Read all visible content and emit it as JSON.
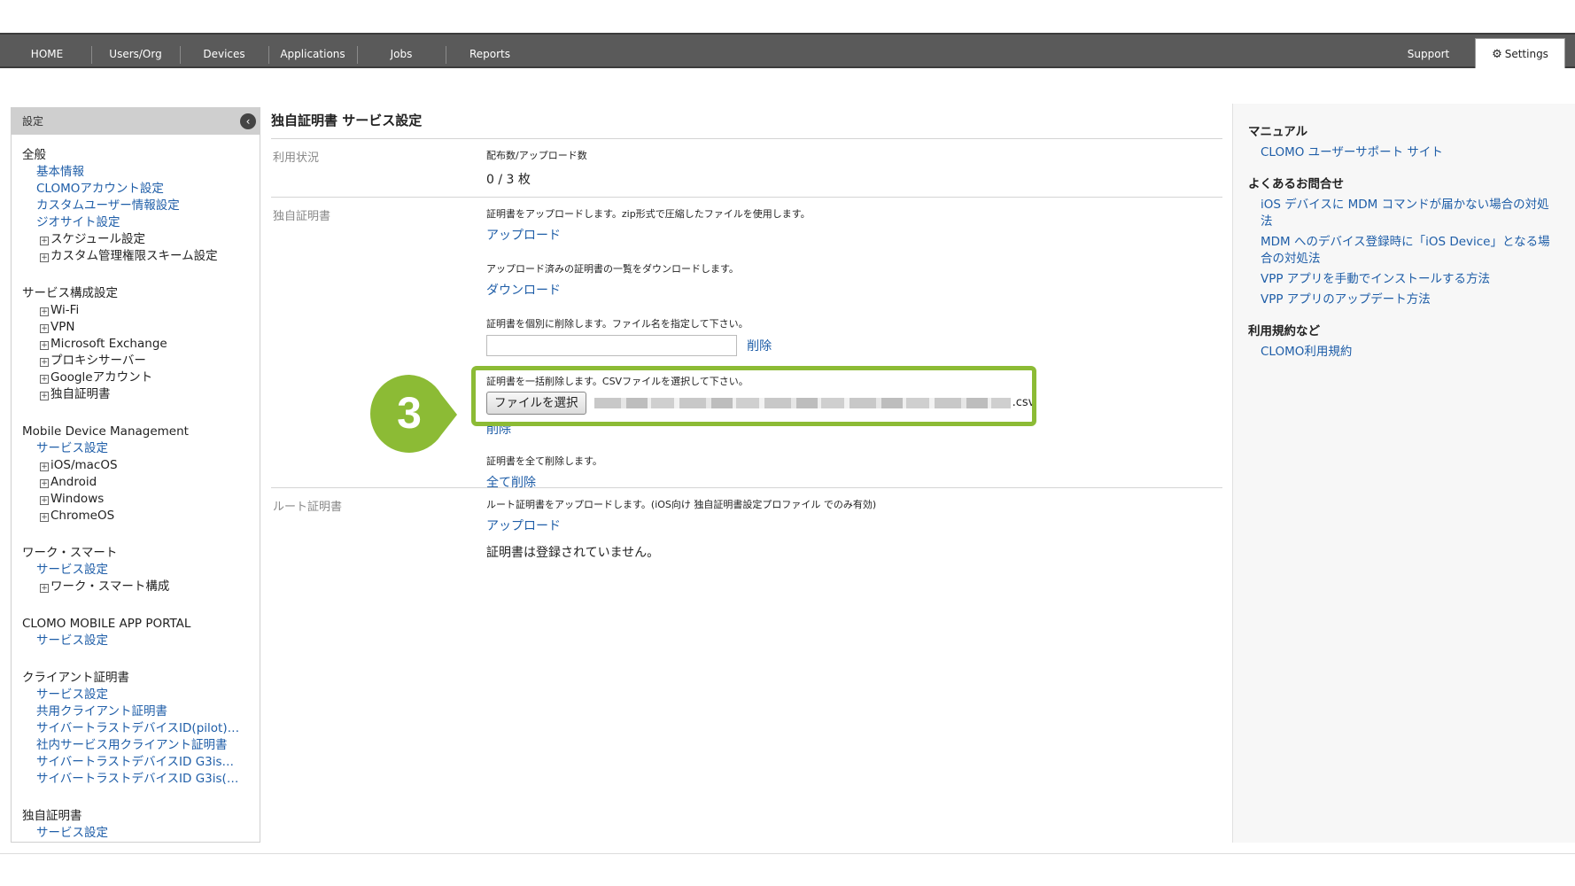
{
  "nav": {
    "items": [
      "HOME",
      "Users/Org",
      "Devices",
      "Applications",
      "Jobs",
      "Reports"
    ],
    "support": "Support",
    "settings": "Settings"
  },
  "sidebar": {
    "header": "設定",
    "groups": [
      {
        "title": "全般",
        "items": [
          {
            "label": "基本情報",
            "type": "link"
          },
          {
            "label": "CLOMOアカウント設定",
            "type": "link"
          },
          {
            "label": "カスタムユーザー情報設定",
            "type": "link"
          },
          {
            "label": "ジオサイト設定",
            "type": "link"
          },
          {
            "label": "スケジュール設定",
            "type": "expand"
          },
          {
            "label": "カスタム管理権限スキーム設定",
            "type": "expand"
          }
        ]
      },
      {
        "title": "サービス構成設定",
        "items": [
          {
            "label": "Wi-Fi",
            "type": "expand"
          },
          {
            "label": "VPN",
            "type": "expand"
          },
          {
            "label": "Microsoft Exchange",
            "type": "expand"
          },
          {
            "label": "プロキシサーバー",
            "type": "expand"
          },
          {
            "label": "Googleアカウント",
            "type": "expand"
          },
          {
            "label": "独自証明書",
            "type": "expand"
          }
        ]
      },
      {
        "title": "Mobile Device Management",
        "items": [
          {
            "label": "サービス設定",
            "type": "link"
          },
          {
            "label": "iOS/macOS",
            "type": "expand"
          },
          {
            "label": "Android",
            "type": "expand"
          },
          {
            "label": "Windows",
            "type": "expand"
          },
          {
            "label": "ChromeOS",
            "type": "expand"
          }
        ]
      },
      {
        "title": "ワーク・スマート",
        "items": [
          {
            "label": "サービス設定",
            "type": "link"
          },
          {
            "label": "ワーク・スマート構成",
            "type": "expand"
          }
        ]
      },
      {
        "title": "CLOMO MOBILE APP PORTAL",
        "items": [
          {
            "label": "サービス設定",
            "type": "link"
          }
        ]
      },
      {
        "title": "クライアント証明書",
        "items": [
          {
            "label": "サービス設定",
            "type": "link"
          },
          {
            "label": "共用クライアント証明書",
            "type": "link"
          },
          {
            "label": "サイバートラストデバイスID(pilot)…",
            "type": "link"
          },
          {
            "label": "社内サービス用クライアント証明書",
            "type": "link"
          },
          {
            "label": "サイバートラストデバイスID G3is…",
            "type": "link"
          },
          {
            "label": "サイバートラストデバイスID G3is(…",
            "type": "link"
          }
        ]
      },
      {
        "title": "独自証明書",
        "items": [
          {
            "label": "サービス設定",
            "type": "link"
          }
        ]
      }
    ]
  },
  "main": {
    "title": "独自証明書 サービス設定",
    "usage": {
      "label": "利用状況",
      "note": "配布数/アップロード数",
      "value": "0 / 3 枚"
    },
    "cert": {
      "label": "独自証明書",
      "upload_note": "証明書をアップロードします。zip形式で圧縮したファイルを使用します。",
      "upload_link": "アップロード",
      "download_note": "アップロード済みの証明書の一覧をダウンロードします。",
      "download_link": "ダウンロード",
      "delete_one_note": "証明書を個別に削除します。ファイル名を指定して下さい。",
      "delete_one_link": "削除",
      "bulk_note": "証明書を一括削除します。CSVファイルを選択して下さい。",
      "choose_file": "ファイルを選択",
      "file_ext": ".csv",
      "bulk_delete_link": "削除",
      "delete_all_note": "証明書を全て削除します。",
      "delete_all_link": "全て削除"
    },
    "root": {
      "label": "ルート証明書",
      "upload_note": "ルート証明書をアップロードします。(iOS向け 独自証明書設定プロファイル でのみ有効)",
      "upload_link": "アップロード",
      "status": "証明書は登録されていません。"
    }
  },
  "badge": {
    "number": "3",
    "color": "#8cbb35"
  },
  "right": {
    "sections": [
      {
        "title": "マニュアル",
        "links": [
          "CLOMO ユーザーサポート サイト"
        ]
      },
      {
        "title": "よくあるお問合せ",
        "links": [
          "iOS デバイスに MDM コマンドが届かない場合の対処法",
          "MDM へのデバイス登録時に「iOS Device」となる場合の対処法",
          "VPP アプリを手動でインストールする方法",
          "VPP アプリのアップデート方法"
        ]
      },
      {
        "title": "利用規約など",
        "links": [
          "CLOMO利用規約"
        ]
      }
    ]
  }
}
